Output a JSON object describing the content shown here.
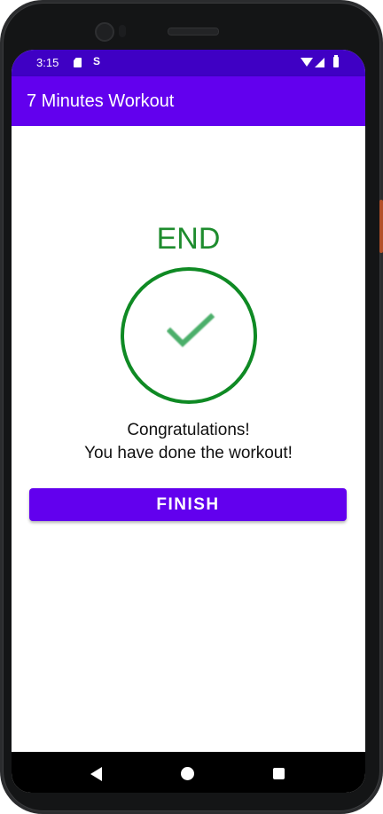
{
  "status_bar": {
    "time": "3:15",
    "notification_icons": [
      "sd-card-icon",
      "s-icon"
    ],
    "system_icons": [
      "wifi-icon",
      "signal-icon",
      "battery-icon"
    ],
    "s_glyph": "S"
  },
  "app_bar": {
    "title": "7 Minutes Workout",
    "color": "#6200ee"
  },
  "main": {
    "end_label": "END",
    "end_color": "#1e8c2e",
    "check_icon": "checkmark-icon",
    "check_color": "#0f8a24",
    "congrats_line1": "Congratulations!",
    "congrats_line2": "You have done the workout!",
    "finish_button_label": "FINISH"
  },
  "nav_bar": {
    "icons": [
      "back-icon",
      "home-icon",
      "recents-icon"
    ]
  }
}
